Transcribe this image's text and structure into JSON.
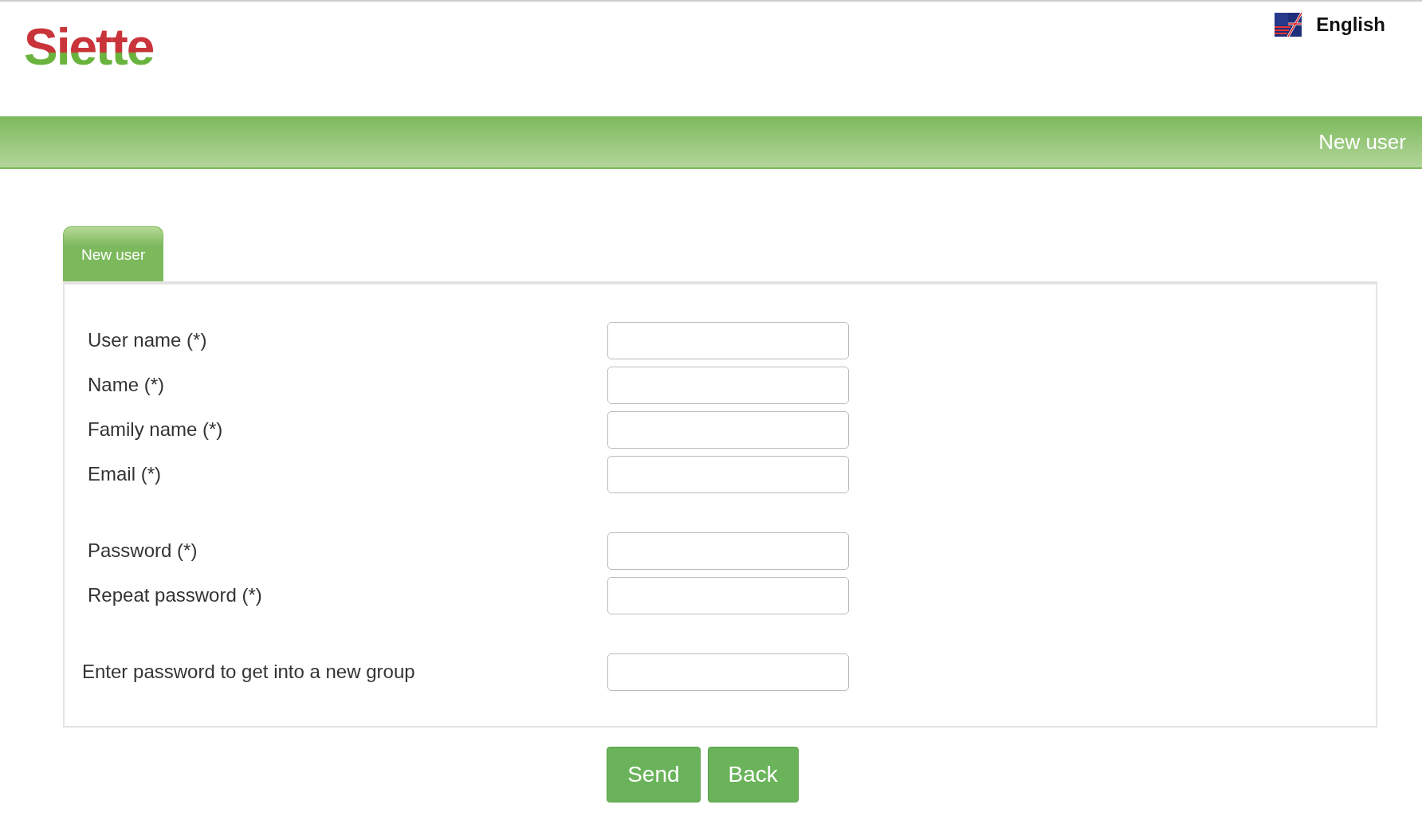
{
  "header": {
    "logo": "Siette",
    "language": "English"
  },
  "banner": {
    "title": "New user"
  },
  "tabs": [
    {
      "label": "New user",
      "selected": true
    }
  ],
  "form": {
    "groups": [
      {
        "fields": [
          {
            "label": "User name (*)"
          },
          {
            "label": "Name (*)"
          },
          {
            "label": "Family name (*)"
          },
          {
            "label": "Email (*)"
          }
        ]
      },
      {
        "fields": [
          {
            "label": "Password (*)"
          },
          {
            "label": "Repeat password (*)"
          }
        ]
      },
      {
        "fields": [
          {
            "label": "Enter password to get into a new group"
          }
        ]
      }
    ]
  },
  "buttons": [
    "Send",
    "Back"
  ]
}
